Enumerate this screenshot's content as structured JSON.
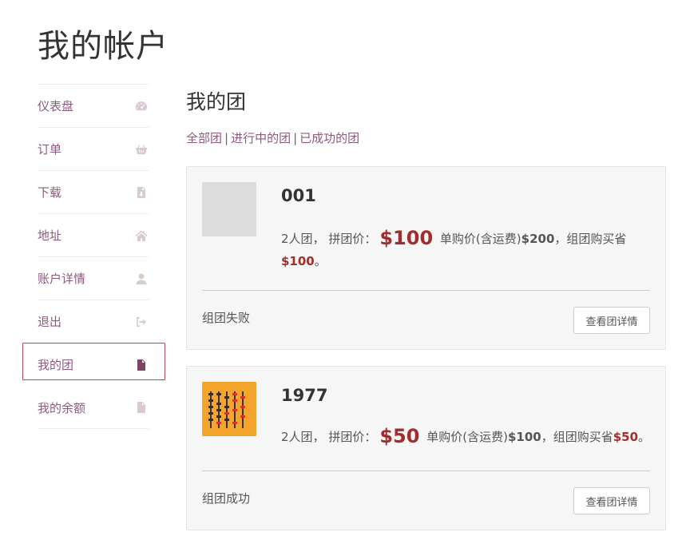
{
  "page_title": "我的帐户",
  "sidebar": {
    "items": [
      {
        "label": "仪表盘",
        "icon": "dashboard-icon"
      },
      {
        "label": "订单",
        "icon": "basket-icon"
      },
      {
        "label": "下载",
        "icon": "file-download-icon"
      },
      {
        "label": "地址",
        "icon": "home-icon"
      },
      {
        "label": "账户详情",
        "icon": "user-icon"
      },
      {
        "label": "退出",
        "icon": "sign-out-icon"
      },
      {
        "label": "我的团",
        "icon": "document-icon",
        "active": true
      },
      {
        "label": "我的余额",
        "icon": "document-icon"
      }
    ]
  },
  "main": {
    "title": "我的团",
    "filters": [
      "全部团",
      "进行中的团",
      "已成功的团"
    ],
    "filter_separator": "|",
    "groups": [
      {
        "name": "001",
        "team_size": "2人团，",
        "group_price_label": "拼团价：",
        "group_price": "$100",
        "single_label": "单购价(含运费)",
        "single_price": "$200",
        "save_label": "，组团购买省",
        "save_amount": "$100",
        "end": "。",
        "status": "组团失败",
        "button": "查看团详情"
      },
      {
        "name": "1977",
        "team_size": "2人团，",
        "group_price_label": "拼团价：",
        "group_price": "$50",
        "single_label": "单购价(含运费)",
        "single_price": "$100",
        "save_label": "，组团购买省",
        "save_amount": "$50",
        "end": "。",
        "status": "组团成功",
        "button": "查看团详情"
      }
    ]
  },
  "colors": {
    "link": "#8b5a7e",
    "price": "#a12d2d",
    "active_border": "#c0464f",
    "card_bg": "#f6f6f6"
  }
}
